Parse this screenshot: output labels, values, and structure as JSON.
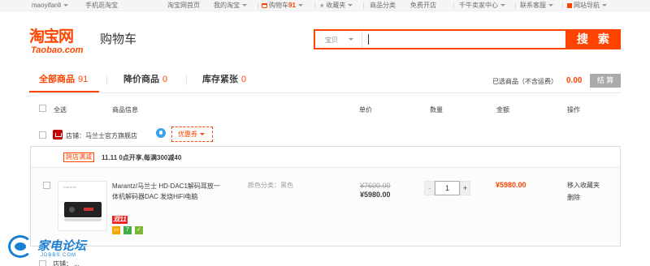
{
  "topbar": {
    "username": "maoyifanll",
    "mobile": "手机逛淘宝",
    "home": "淘宝网首页",
    "my_taobao": "我的淘宝",
    "cart_label": "购物车",
    "cart_count": "91",
    "favorites": "收藏夹",
    "categories": "商品分类",
    "free_shop": "免费开店",
    "seller_center": "千牛卖家中心",
    "support": "联系客服",
    "site_nav": "网站导航"
  },
  "header": {
    "logo_cn": "淘宝网",
    "logo_en": "Taobao.com",
    "title": "购物车"
  },
  "search": {
    "scope": "宝贝",
    "value": "",
    "button": "搜 索"
  },
  "tabs": [
    {
      "label": "全部商品",
      "count": "91"
    },
    {
      "label": "降价商品",
      "count": "0"
    },
    {
      "label": "库存紧张",
      "count": "0"
    }
  ],
  "summary": {
    "selected_label": "已选商品（不含运费）",
    "total": "0.00",
    "checkout": "结 算"
  },
  "columns": {
    "select_all": "全选",
    "product": "商品信息",
    "unit_price": "单价",
    "quantity": "数量",
    "amount": "金额",
    "actions": "操作"
  },
  "shop": {
    "label": "店铺：马兰士官方旗舰店",
    "coupon": "优惠券"
  },
  "promo": {
    "tag": "跨店满减",
    "text": "11.11 0点开享,每满300减40"
  },
  "item": {
    "thumb_brand": "marantz",
    "title": "Marantz/马兰士 HD-DAC1解码耳放一体机解码器DAC 发烧HiFi电脑",
    "badge": "双11",
    "sku": "颜色分类：黑色",
    "price_original": "¥7600.00",
    "price_now": "¥5980.00",
    "quantity": "1",
    "subtotal": "¥5980.00",
    "action_favorite": "移入收藏夹",
    "action_delete": "删除"
  },
  "next_shop": {
    "label": "店铺：  ..."
  },
  "watermark": {
    "text": "家电论坛",
    "sub": "JDBBS.COM"
  },
  "colors": {
    "accent": "#ff4400",
    "checkout_disabled": "#aaaaaa",
    "watermark_blue": "#1c7fd1"
  }
}
